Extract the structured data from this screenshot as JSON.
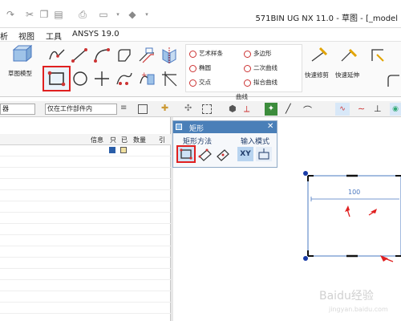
{
  "titlebar": {
    "app_title": "571BIN UG NX 11.0 - 草图 - [_model"
  },
  "menu": {
    "items": [
      "析",
      "视图",
      "工具",
      "ANSYS 19.0"
    ]
  },
  "ribbon": {
    "feature_label": "草图模型",
    "curve_group": {
      "art_spline": "艺术样条",
      "polygon": "多边形",
      "ellipse": "椭圆",
      "conic": "二次曲线",
      "intersection_point": "交点",
      "fit_curve": "拟合曲线",
      "group_label": "曲线"
    },
    "quick_trim": "快速修剪",
    "quick_extend": "快速延伸"
  },
  "selection": {
    "filter_value": "器",
    "scope_value": "仅在工作部件内"
  },
  "navigator": {
    "columns": [
      "信息",
      "只",
      "已",
      "数量",
      "引"
    ]
  },
  "dialog": {
    "title": "矩形",
    "method_label": "矩形方法",
    "input_mode_label": "输入模式",
    "xy_button": "XY"
  },
  "canvas": {
    "dimension": "100"
  },
  "watermark": "Baidu 经验 jingyan.baidu.com",
  "colors": {
    "accent_red": "#e02020",
    "dialog_title": "#4a7fb8",
    "sketch_blue": "#4a78c0"
  }
}
